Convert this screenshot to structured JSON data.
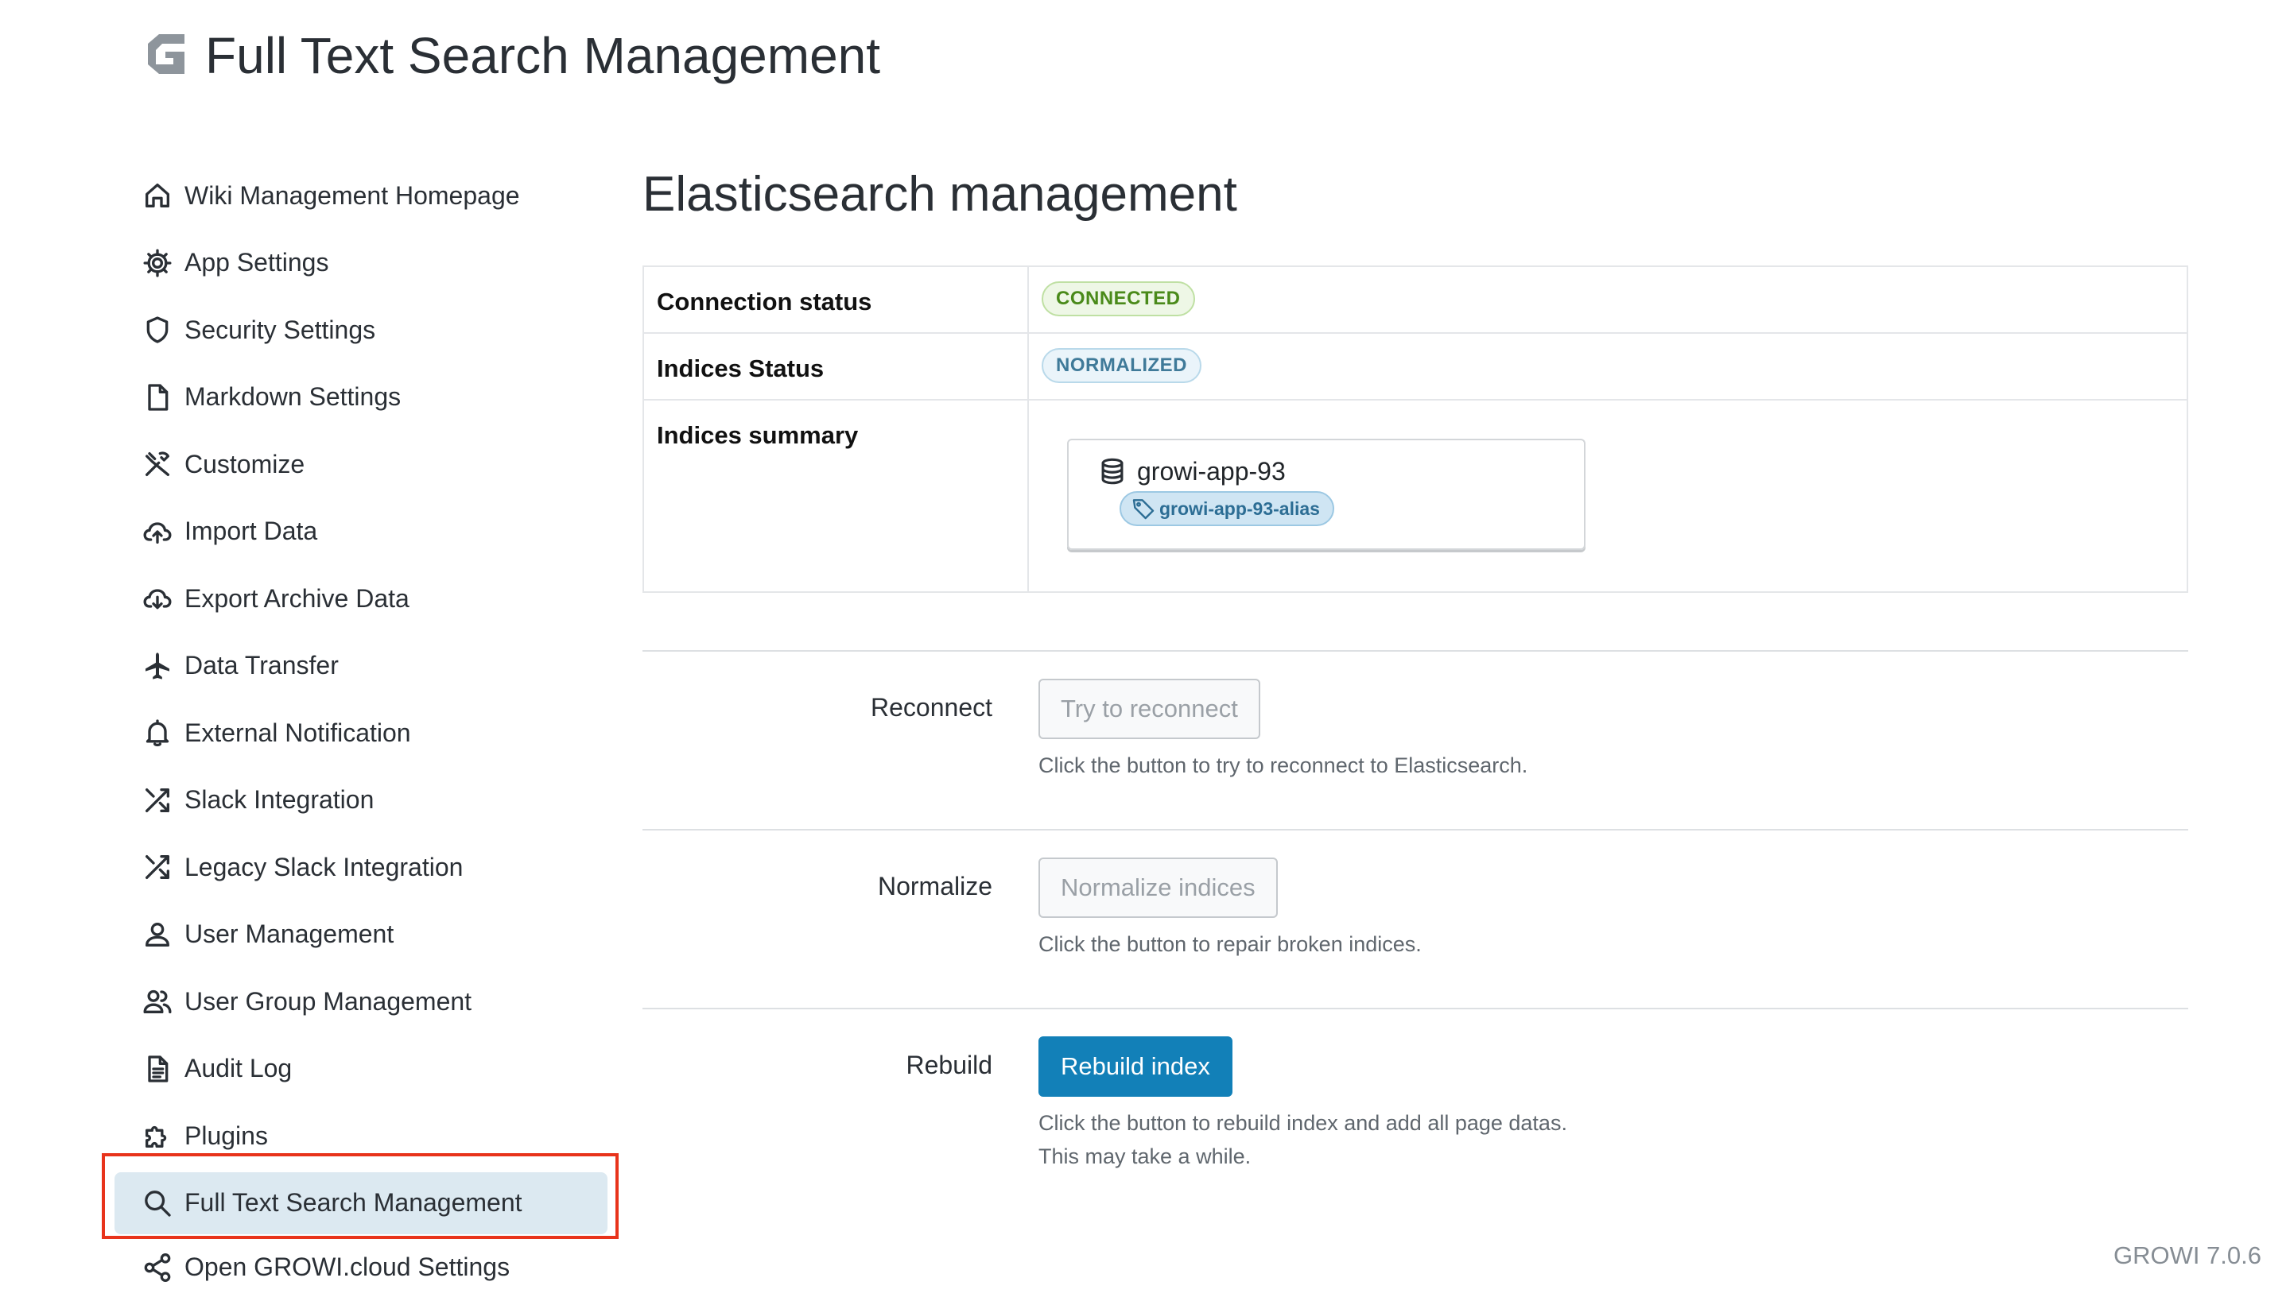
{
  "header": {
    "title": "Full Text Search Management",
    "logo_icon": "growi-logo-icon"
  },
  "sidebar": {
    "items": [
      {
        "label": "Wiki Management Homepage",
        "icon": "home-icon"
      },
      {
        "label": "App Settings",
        "icon": "gear-icon"
      },
      {
        "label": "Security Settings",
        "icon": "shield-icon"
      },
      {
        "label": "Markdown Settings",
        "icon": "file-icon"
      },
      {
        "label": "Customize",
        "icon": "tools-icon"
      },
      {
        "label": "Import Data",
        "icon": "cloud-upload-icon"
      },
      {
        "label": "Export Archive Data",
        "icon": "cloud-download-icon"
      },
      {
        "label": "Data Transfer",
        "icon": "airplane-icon"
      },
      {
        "label": "External Notification",
        "icon": "bell-icon"
      },
      {
        "label": "Slack Integration",
        "icon": "shuffle-icon"
      },
      {
        "label": "Legacy Slack Integration",
        "icon": "shuffle-icon"
      },
      {
        "label": "User Management",
        "icon": "user-icon"
      },
      {
        "label": "User Group Management",
        "icon": "users-icon"
      },
      {
        "label": "Audit Log",
        "icon": "document-icon"
      },
      {
        "label": "Plugins",
        "icon": "puzzle-icon"
      },
      {
        "label": "Full Text Search Management",
        "icon": "search-icon",
        "active": true
      },
      {
        "label": "Open GROWI.cloud Settings",
        "icon": "share-icon"
      }
    ]
  },
  "main": {
    "title": "Elasticsearch management",
    "status": {
      "connection_label": "Connection status",
      "connection_value": "CONNECTED",
      "indices_status_label": "Indices Status",
      "indices_status_value": "NORMALIZED",
      "summary_label": "Indices summary",
      "index_name": "growi-app-93",
      "index_alias": "growi-app-93-alias"
    },
    "reconnect": {
      "label": "Reconnect",
      "button": "Try to reconnect",
      "help": "Click the button to try to reconnect to Elasticsearch."
    },
    "normalize": {
      "label": "Normalize",
      "button": "Normalize indices",
      "help": "Click the button to repair broken indices."
    },
    "rebuild": {
      "label": "Rebuild",
      "button": "Rebuild index",
      "help_line1": "Click the button to rebuild index and add all page datas.",
      "help_line2": "This may take a while."
    }
  },
  "footer": {
    "version": "GROWI 7.0.6"
  },
  "colors": {
    "primary": "#1280b8",
    "active_nav_bg": "#dce9f1",
    "highlight_border": "#e8331b",
    "connected": "#4a8a1a",
    "normalized": "#3f7a99"
  }
}
